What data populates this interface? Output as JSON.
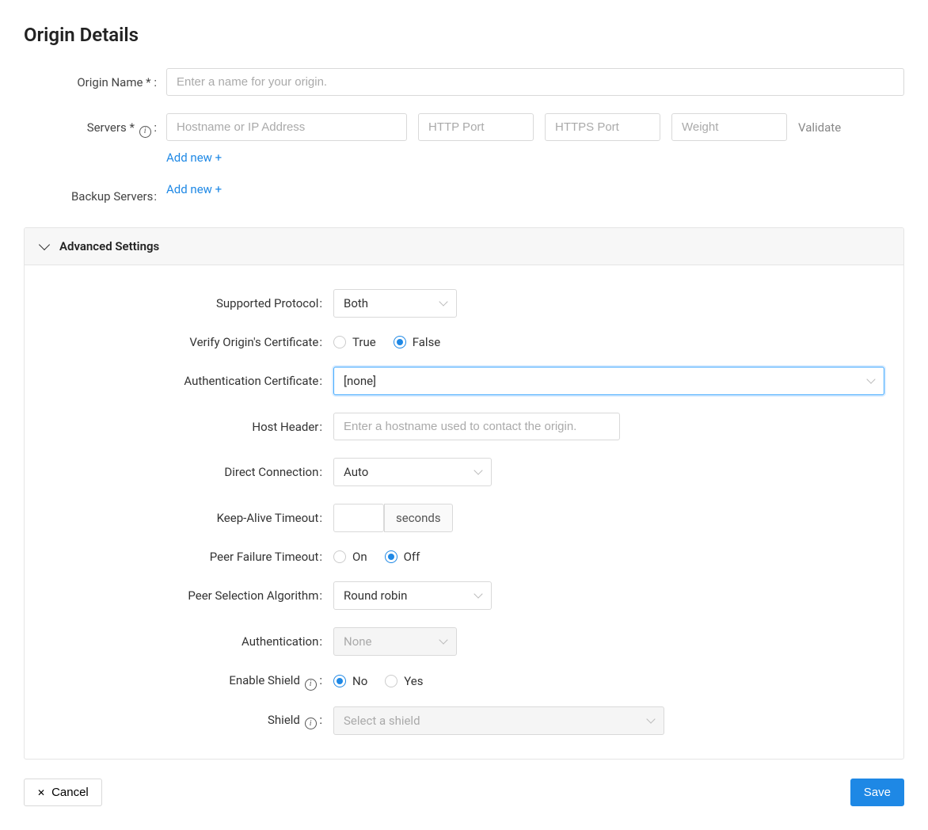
{
  "title": "Origin Details",
  "labels": {
    "origin_name": "Origin Name",
    "servers": "Servers",
    "backup_servers": "Backup Servers"
  },
  "fields": {
    "origin_name_placeholder": "Enter a name for your origin.",
    "server_host_placeholder": "Hostname or IP Address",
    "server_http_placeholder": "HTTP Port",
    "server_https_placeholder": "HTTPS Port",
    "server_weight_placeholder": "Weight",
    "validate": "Validate",
    "add_new": "Add new +"
  },
  "advanced": {
    "header": "Advanced Settings",
    "supported_protocol": {
      "label": "Supported Protocol",
      "value": "Both"
    },
    "verify_cert": {
      "label": "Verify Origin's Certificate",
      "true": "True",
      "false": "False",
      "selected": "false"
    },
    "auth_cert": {
      "label": "Authentication Certificate",
      "value": "[none]"
    },
    "host_header": {
      "label": "Host Header",
      "placeholder": "Enter a hostname used to contact the origin."
    },
    "direct_connection": {
      "label": "Direct Connection",
      "value": "Auto"
    },
    "keep_alive": {
      "label": "Keep-Alive Timeout",
      "unit": "seconds"
    },
    "peer_failure": {
      "label": "Peer Failure Timeout",
      "on": "On",
      "off": "Off",
      "selected": "off"
    },
    "peer_selection": {
      "label": "Peer Selection Algorithm",
      "value": "Round robin"
    },
    "authentication": {
      "label": "Authentication",
      "value": "None"
    },
    "enable_shield": {
      "label": "Enable Shield",
      "no": "No",
      "yes": "Yes",
      "selected": "no"
    },
    "shield": {
      "label": "Shield",
      "placeholder": "Select a shield"
    }
  },
  "footer": {
    "cancel": "Cancel",
    "save": "Save"
  }
}
